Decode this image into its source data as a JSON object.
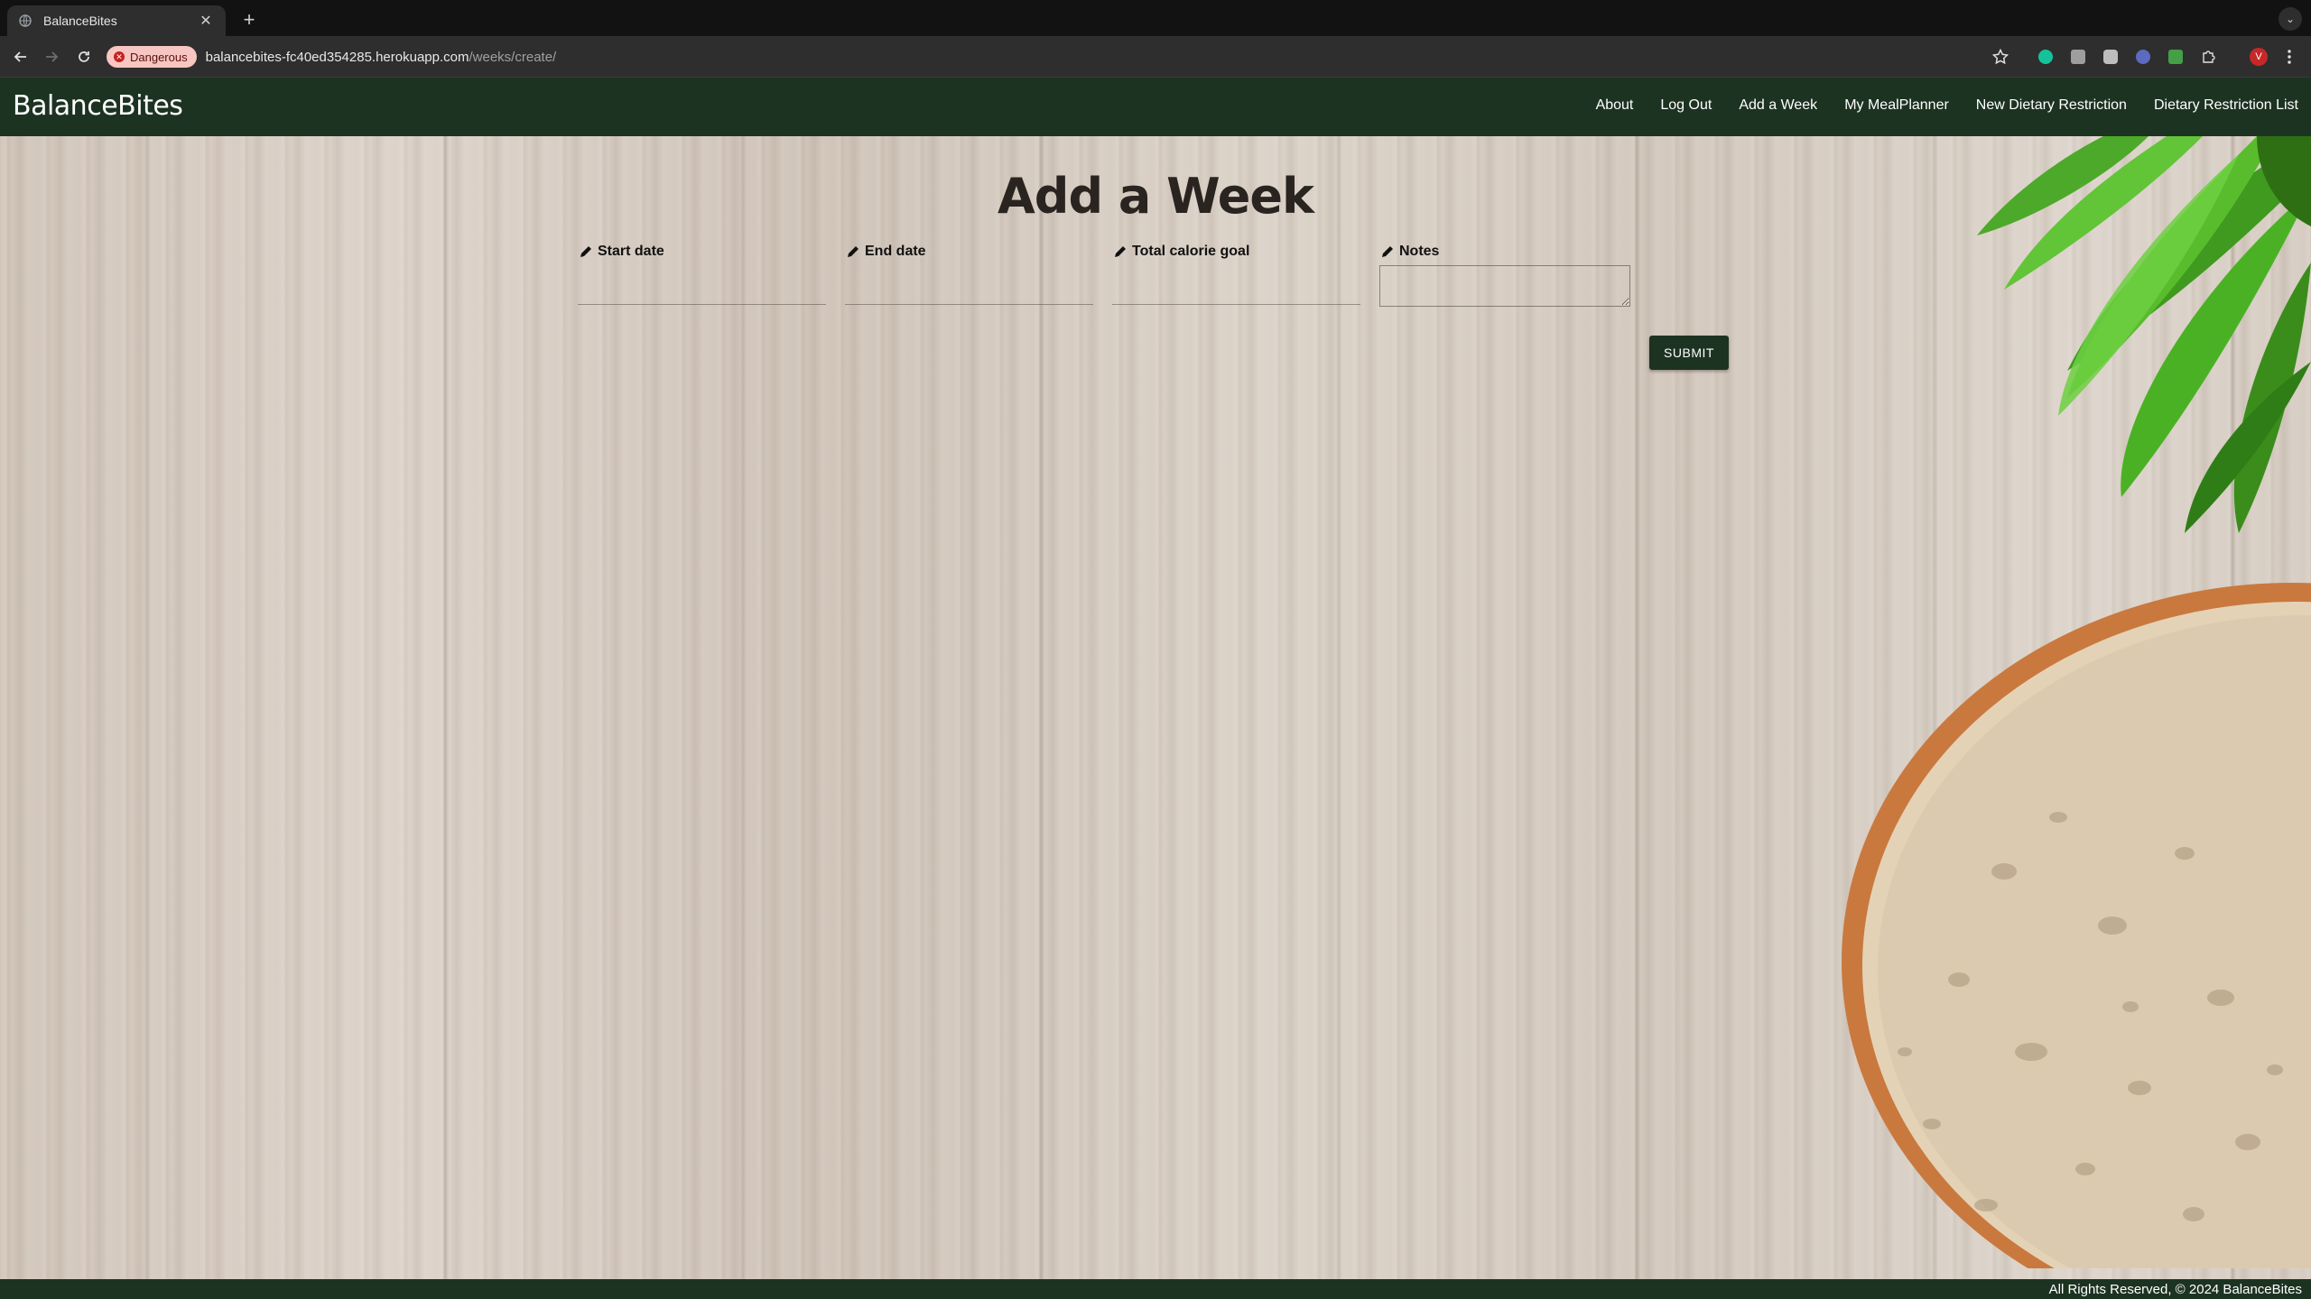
{
  "browser": {
    "tab_title": "BalanceBites",
    "security_label": "Dangerous",
    "url_host": "balancebites-fc40ed354285.herokuapp.com",
    "url_path": "/weeks/create/",
    "profile_initial": "V"
  },
  "nav": {
    "brand": "BalanceBites",
    "links": [
      "About",
      "Log Out",
      "Add a Week",
      "My MealPlanner",
      "New Dietary Restriction",
      "Dietary Restriction List"
    ]
  },
  "form": {
    "title": "Add a Week",
    "fields": {
      "start_date": "Start date",
      "end_date": "End date",
      "calorie_goal": "Total calorie goal",
      "notes": "Notes"
    },
    "submit_label": "SUBMIT"
  },
  "footer": {
    "text": "All Rights Reserved, © 2024 BalanceBites"
  },
  "colors": {
    "nav_bg": "#1d3322",
    "danger_chip": "#f7c6c2"
  }
}
